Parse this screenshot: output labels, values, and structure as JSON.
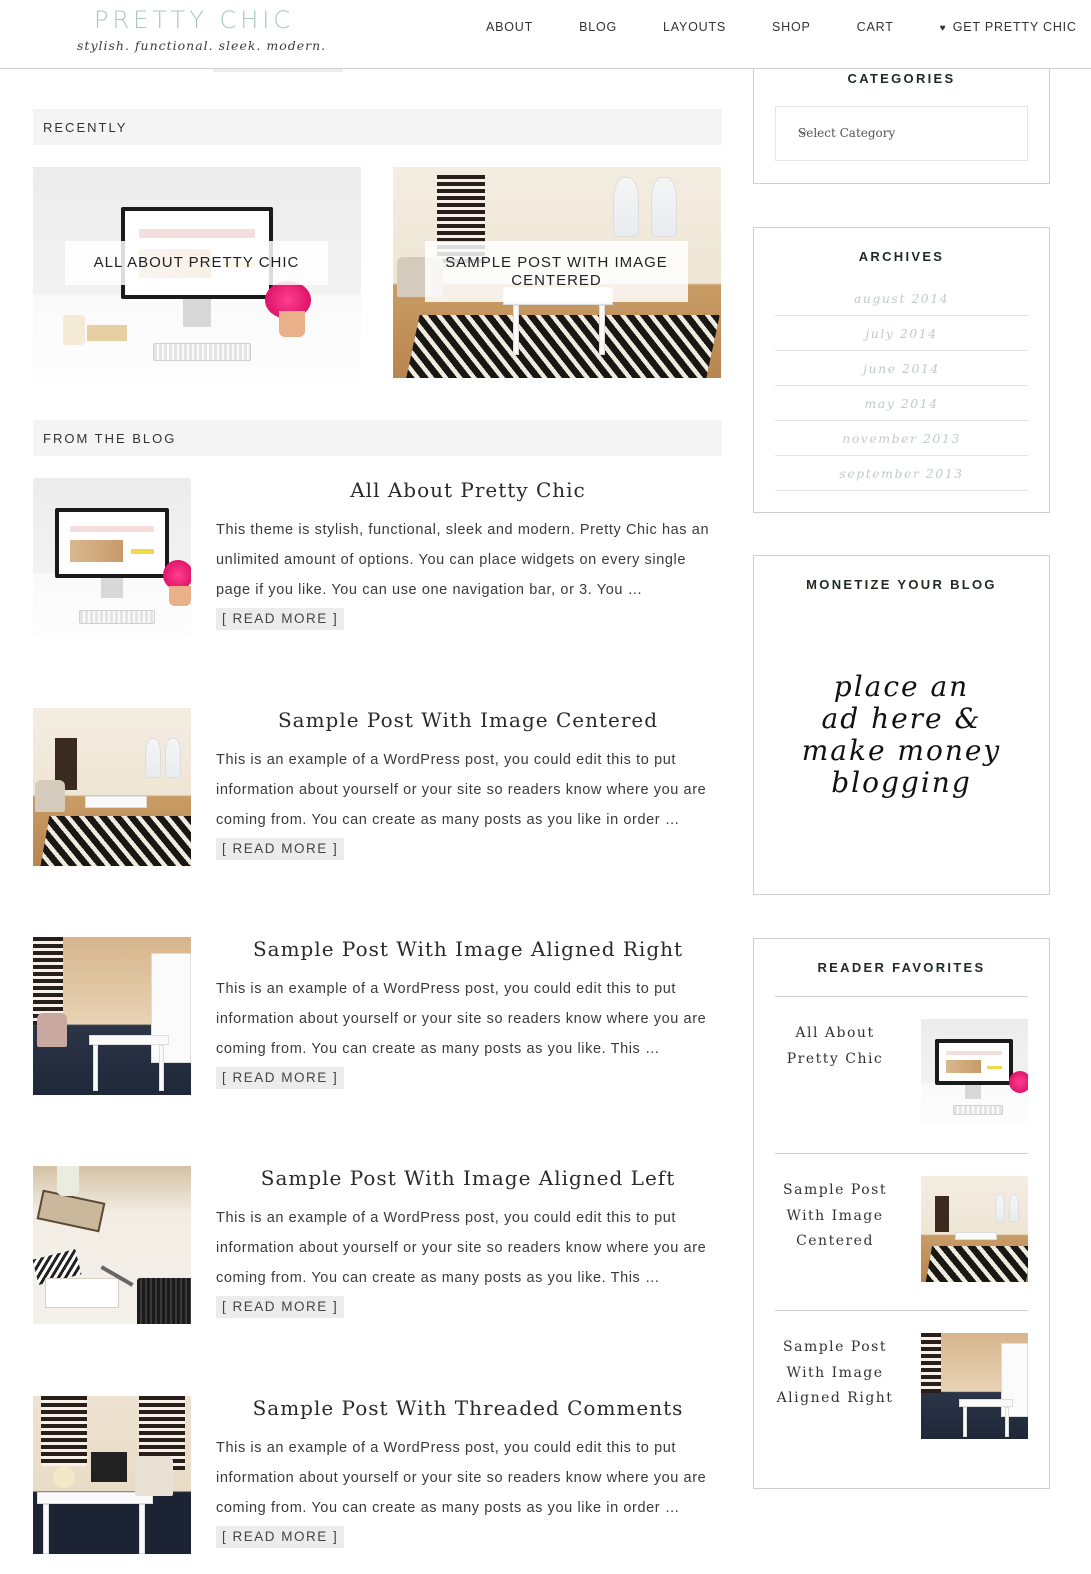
{
  "header": {
    "logo_title": "PRETTY CHIC",
    "logo_tagline": "stylish. functional. sleek. modern.",
    "brand_color": "#a8c9b9",
    "nav": [
      {
        "label": "ABOUT"
      },
      {
        "label": "BLOG"
      },
      {
        "label": "LAYOUTS"
      },
      {
        "label": "SHOP"
      },
      {
        "label": "CART"
      },
      {
        "label": "GET PRETTY CHIC",
        "icon": "heart-icon",
        "glyph": "♥"
      }
    ]
  },
  "recently": {
    "title": "RECENTLY",
    "tiles": [
      {
        "label": "ALL ABOUT PRETTY CHIC",
        "image": "desk-computer-image"
      },
      {
        "label": "SAMPLE POST WITH IMAGE CENTERED",
        "image": "dining-room-image"
      }
    ]
  },
  "blog": {
    "title": "FROM THE BLOG",
    "read_more_label": "[ READ MORE ]",
    "posts": [
      {
        "title": "All About Pretty Chic",
        "excerpt": "This theme is stylish, functional, sleek and modern. Pretty Chic has an unlimited amount of options. You can place widgets on every single page if you like. You can use one navigation bar, or 3. You …",
        "read_more": "[ READ MORE ]",
        "image": "desk-computer-image"
      },
      {
        "title": "Sample Post With Image Centered",
        "excerpt": "This is an example of a WordPress post, you could edit this to put information about yourself or your site so readers know where you are coming from. You can create as many posts as you like in order …",
        "read_more": "[ READ MORE ]",
        "image": "dining-room-image"
      },
      {
        "title": "Sample Post With Image Aligned Right",
        "excerpt": "This is an example of a WordPress post, you could edit this to put information about yourself or your site so readers know where you are coming from. You can create as many posts as you like. This …",
        "read_more": "[ READ MORE ]",
        "image": "living-room-image"
      },
      {
        "title": "Sample Post With Image Aligned Left",
        "excerpt": "This is an example of a WordPress post, you could edit this to put information about yourself or your site so readers know where you are coming from. You can create as many posts as you like. This …",
        "read_more": "[ READ MORE ]",
        "image": "desk-stationery-image"
      },
      {
        "title": "Sample Post With Threaded Comments",
        "excerpt": "This is an example of a WordPress post, you could edit this to put information about yourself or your site so readers know where you are coming from. You can create as many posts as you like in order …",
        "read_more": "[ READ MORE ]",
        "image": "home-office-image"
      }
    ]
  },
  "sidebar": {
    "categories": {
      "title": "CATEGORIES",
      "select_value": "Select Category",
      "chevron": "⌄"
    },
    "archives": {
      "title": "ARCHIVES",
      "items": [
        "august 2014",
        "july 2014",
        "june 2014",
        "may 2014",
        "november 2013",
        "september 2013"
      ]
    },
    "monetize": {
      "title": "MONETIZE YOUR BLOG",
      "ad_lines": [
        "place an",
        "ad here &",
        "make money",
        "blogging"
      ]
    },
    "favorites": {
      "title": "READER FAVORITES",
      "items": [
        {
          "title": "All About Pretty Chic",
          "image": "desk-computer-image"
        },
        {
          "title": "Sample Post With Image Centered",
          "image": "dining-room-image"
        },
        {
          "title": "Sample Post With Image Aligned Right",
          "image": "living-room-image"
        }
      ]
    }
  }
}
